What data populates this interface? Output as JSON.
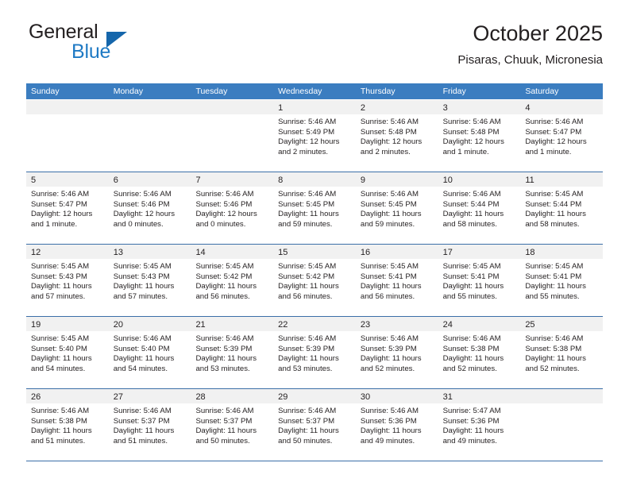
{
  "brand": {
    "name_part1": "General",
    "name_part2": "Blue",
    "triangle_color": "#1566ab",
    "blue_text_color": "#1f7ac4"
  },
  "header": {
    "title": "October 2025",
    "subtitle": "Pisaras, Chuuk, Micronesia"
  },
  "theme": {
    "header_row_bg": "#3b7dc0",
    "header_row_text": "#ffffff",
    "day_band_bg": "#f1f1f1",
    "row_divider": "#3b6fa8",
    "body_text": "#231f20"
  },
  "weekdays": [
    "Sunday",
    "Monday",
    "Tuesday",
    "Wednesday",
    "Thursday",
    "Friday",
    "Saturday"
  ],
  "weeks": [
    [
      {
        "day": "",
        "lines": []
      },
      {
        "day": "",
        "lines": []
      },
      {
        "day": "",
        "lines": []
      },
      {
        "day": "1",
        "lines": [
          "Sunrise: 5:46 AM",
          "Sunset: 5:49 PM",
          "Daylight: 12 hours",
          "and 2 minutes."
        ]
      },
      {
        "day": "2",
        "lines": [
          "Sunrise: 5:46 AM",
          "Sunset: 5:48 PM",
          "Daylight: 12 hours",
          "and 2 minutes."
        ]
      },
      {
        "day": "3",
        "lines": [
          "Sunrise: 5:46 AM",
          "Sunset: 5:48 PM",
          "Daylight: 12 hours",
          "and 1 minute."
        ]
      },
      {
        "day": "4",
        "lines": [
          "Sunrise: 5:46 AM",
          "Sunset: 5:47 PM",
          "Daylight: 12 hours",
          "and 1 minute."
        ]
      }
    ],
    [
      {
        "day": "5",
        "lines": [
          "Sunrise: 5:46 AM",
          "Sunset: 5:47 PM",
          "Daylight: 12 hours",
          "and 1 minute."
        ]
      },
      {
        "day": "6",
        "lines": [
          "Sunrise: 5:46 AM",
          "Sunset: 5:46 PM",
          "Daylight: 12 hours",
          "and 0 minutes."
        ]
      },
      {
        "day": "7",
        "lines": [
          "Sunrise: 5:46 AM",
          "Sunset: 5:46 PM",
          "Daylight: 12 hours",
          "and 0 minutes."
        ]
      },
      {
        "day": "8",
        "lines": [
          "Sunrise: 5:46 AM",
          "Sunset: 5:45 PM",
          "Daylight: 11 hours",
          "and 59 minutes."
        ]
      },
      {
        "day": "9",
        "lines": [
          "Sunrise: 5:46 AM",
          "Sunset: 5:45 PM",
          "Daylight: 11 hours",
          "and 59 minutes."
        ]
      },
      {
        "day": "10",
        "lines": [
          "Sunrise: 5:46 AM",
          "Sunset: 5:44 PM",
          "Daylight: 11 hours",
          "and 58 minutes."
        ]
      },
      {
        "day": "11",
        "lines": [
          "Sunrise: 5:45 AM",
          "Sunset: 5:44 PM",
          "Daylight: 11 hours",
          "and 58 minutes."
        ]
      }
    ],
    [
      {
        "day": "12",
        "lines": [
          "Sunrise: 5:45 AM",
          "Sunset: 5:43 PM",
          "Daylight: 11 hours",
          "and 57 minutes."
        ]
      },
      {
        "day": "13",
        "lines": [
          "Sunrise: 5:45 AM",
          "Sunset: 5:43 PM",
          "Daylight: 11 hours",
          "and 57 minutes."
        ]
      },
      {
        "day": "14",
        "lines": [
          "Sunrise: 5:45 AM",
          "Sunset: 5:42 PM",
          "Daylight: 11 hours",
          "and 56 minutes."
        ]
      },
      {
        "day": "15",
        "lines": [
          "Sunrise: 5:45 AM",
          "Sunset: 5:42 PM",
          "Daylight: 11 hours",
          "and 56 minutes."
        ]
      },
      {
        "day": "16",
        "lines": [
          "Sunrise: 5:45 AM",
          "Sunset: 5:41 PM",
          "Daylight: 11 hours",
          "and 56 minutes."
        ]
      },
      {
        "day": "17",
        "lines": [
          "Sunrise: 5:45 AM",
          "Sunset: 5:41 PM",
          "Daylight: 11 hours",
          "and 55 minutes."
        ]
      },
      {
        "day": "18",
        "lines": [
          "Sunrise: 5:45 AM",
          "Sunset: 5:41 PM",
          "Daylight: 11 hours",
          "and 55 minutes."
        ]
      }
    ],
    [
      {
        "day": "19",
        "lines": [
          "Sunrise: 5:45 AM",
          "Sunset: 5:40 PM",
          "Daylight: 11 hours",
          "and 54 minutes."
        ]
      },
      {
        "day": "20",
        "lines": [
          "Sunrise: 5:46 AM",
          "Sunset: 5:40 PM",
          "Daylight: 11 hours",
          "and 54 minutes."
        ]
      },
      {
        "day": "21",
        "lines": [
          "Sunrise: 5:46 AM",
          "Sunset: 5:39 PM",
          "Daylight: 11 hours",
          "and 53 minutes."
        ]
      },
      {
        "day": "22",
        "lines": [
          "Sunrise: 5:46 AM",
          "Sunset: 5:39 PM",
          "Daylight: 11 hours",
          "and 53 minutes."
        ]
      },
      {
        "day": "23",
        "lines": [
          "Sunrise: 5:46 AM",
          "Sunset: 5:39 PM",
          "Daylight: 11 hours",
          "and 52 minutes."
        ]
      },
      {
        "day": "24",
        "lines": [
          "Sunrise: 5:46 AM",
          "Sunset: 5:38 PM",
          "Daylight: 11 hours",
          "and 52 minutes."
        ]
      },
      {
        "day": "25",
        "lines": [
          "Sunrise: 5:46 AM",
          "Sunset: 5:38 PM",
          "Daylight: 11 hours",
          "and 52 minutes."
        ]
      }
    ],
    [
      {
        "day": "26",
        "lines": [
          "Sunrise: 5:46 AM",
          "Sunset: 5:38 PM",
          "Daylight: 11 hours",
          "and 51 minutes."
        ]
      },
      {
        "day": "27",
        "lines": [
          "Sunrise: 5:46 AM",
          "Sunset: 5:37 PM",
          "Daylight: 11 hours",
          "and 51 minutes."
        ]
      },
      {
        "day": "28",
        "lines": [
          "Sunrise: 5:46 AM",
          "Sunset: 5:37 PM",
          "Daylight: 11 hours",
          "and 50 minutes."
        ]
      },
      {
        "day": "29",
        "lines": [
          "Sunrise: 5:46 AM",
          "Sunset: 5:37 PM",
          "Daylight: 11 hours",
          "and 50 minutes."
        ]
      },
      {
        "day": "30",
        "lines": [
          "Sunrise: 5:46 AM",
          "Sunset: 5:36 PM",
          "Daylight: 11 hours",
          "and 49 minutes."
        ]
      },
      {
        "day": "31",
        "lines": [
          "Sunrise: 5:47 AM",
          "Sunset: 5:36 PM",
          "Daylight: 11 hours",
          "and 49 minutes."
        ]
      },
      {
        "day": "",
        "lines": []
      }
    ]
  ]
}
